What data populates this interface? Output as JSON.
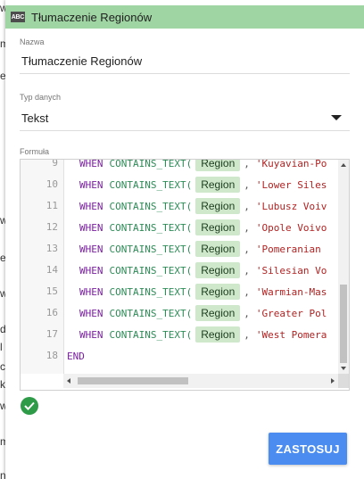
{
  "window": {
    "title": "Tłumaczenie Regionów",
    "type_badge": "ABC"
  },
  "background_fragments": [
    "w",
    "m",
    "el",
    "w",
    "e",
    "w",
    "d",
    "l",
    "co",
    "k",
    "w",
    "m",
    "n"
  ],
  "form": {
    "name_label": "Nazwa",
    "name_value": "Tłumaczenie Regionów",
    "type_label": "Typ danych",
    "type_value": "Tekst",
    "formula_label": "Formuła"
  },
  "formula": {
    "lines": [
      {
        "num": "9",
        "kw": "WHEN",
        "fn": "CONTAINS_TEXT(",
        "field": "Region",
        "sep": ",",
        "str": "'Kuyavian-Po"
      },
      {
        "num": "10",
        "kw": "WHEN",
        "fn": "CONTAINS_TEXT(",
        "field": "Region",
        "sep": ",",
        "str": "'Lower Siles"
      },
      {
        "num": "11",
        "kw": "WHEN",
        "fn": "CONTAINS_TEXT(",
        "field": "Region",
        "sep": ",",
        "str": "'Lubusz Voiv"
      },
      {
        "num": "12",
        "kw": "WHEN",
        "fn": "CONTAINS_TEXT(",
        "field": "Region",
        "sep": ",",
        "str": "'Opole Voivo"
      },
      {
        "num": "13",
        "kw": "WHEN",
        "fn": "CONTAINS_TEXT(",
        "field": "Region",
        "sep": ",",
        "str": "'Pomeranian "
      },
      {
        "num": "14",
        "kw": "WHEN",
        "fn": "CONTAINS_TEXT(",
        "field": "Region",
        "sep": ",",
        "str": "'Silesian Vo"
      },
      {
        "num": "15",
        "kw": "WHEN",
        "fn": "CONTAINS_TEXT(",
        "field": "Region",
        "sep": ",",
        "str": "'Warmian-Mas"
      },
      {
        "num": "16",
        "kw": "WHEN",
        "fn": "CONTAINS_TEXT(",
        "field": "Region",
        "sep": ",",
        "str": "'Greater Pol"
      },
      {
        "num": "17",
        "kw": "WHEN",
        "fn": "CONTAINS_TEXT(",
        "field": "Region",
        "sep": ",",
        "str": "'West Pomera"
      },
      {
        "num": "18",
        "kw": "END",
        "fn": "",
        "field": "",
        "sep": "",
        "str": ""
      }
    ],
    "status": "valid"
  },
  "actions": {
    "apply_label": "ZASTOSUJ"
  },
  "icons": {
    "status": "check-circle-icon",
    "dropdown": "caret-down-icon"
  },
  "colors": {
    "header_bg": "#9fd5a2",
    "apply_bg": "#4a8cf0",
    "valid_green": "#2e9b48",
    "chip_bg": "#cfe8cc"
  }
}
